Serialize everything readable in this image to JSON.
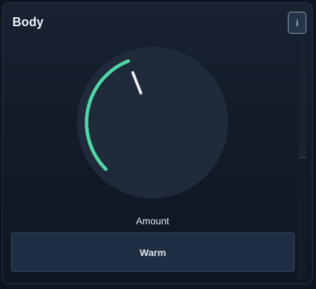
{
  "panel": {
    "title": "Body",
    "info_label": "i"
  },
  "knob": {
    "label": "Amount",
    "value_fraction": 0.42,
    "colors": {
      "face": "#1f2b3b",
      "arc": "#52d6a5",
      "pointer": "#eef1f5"
    }
  },
  "preset": {
    "label": "Warm"
  }
}
